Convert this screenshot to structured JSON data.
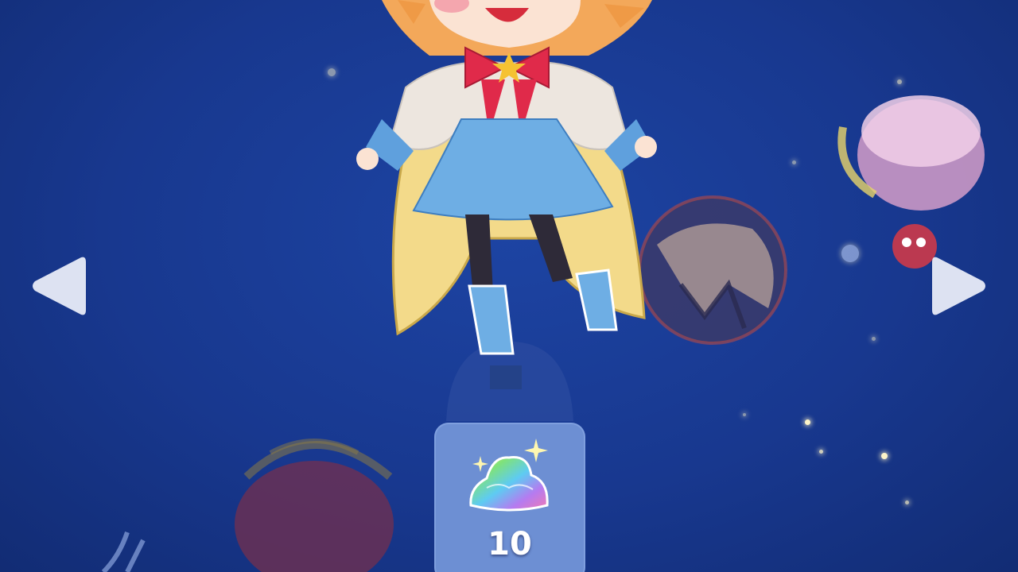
{
  "currency": {
    "icon": "rainbow-crystal-pile-icon",
    "count": "10"
  },
  "navigation": {
    "left_icon": "left-triangle-arrow-icon",
    "right_icon": "right-triangle-arrow-icon"
  },
  "colors": {
    "background": "#17358a",
    "panel": "#6d8fd3",
    "arrow": "#e8ecf8"
  }
}
